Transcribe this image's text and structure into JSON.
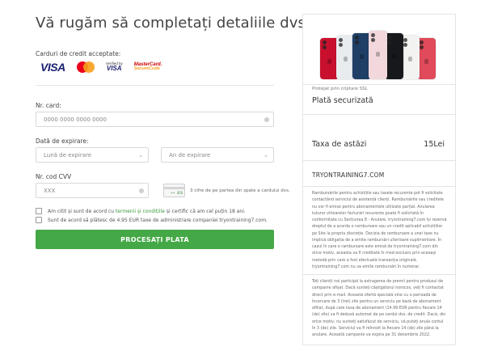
{
  "page": {
    "title": "Vă rugăm să completați detaliile dvs."
  },
  "accepted_cards": {
    "label": "Carduri de credit acceptate:",
    "visa_text": "VISA",
    "verified_top": "Verified by",
    "verified_visa": "VISA",
    "securecode_top": "MasterCard.",
    "securecode_bottom": "SecureCode"
  },
  "form": {
    "card_label": "Nr. card:",
    "card_placeholder": "0000 0000 0000 0000",
    "expiry_label": "Dată de expirare:",
    "month_select": "Lună de expirare",
    "year_select": "An de expirare",
    "cvv_label": "Nr. cod CVV",
    "cvv_placeholder": "XXX",
    "cvv_card_number": "•• 456",
    "cvv_hint": "3 cifre de pe partea din spate a cardului dvs.",
    "terms_before": "Am citit și sunt de acord cu ",
    "terms_link": "termenii și condițiile",
    "terms_after": " și certific că am cel puțin 18 ani.",
    "fee_text": "Sunt de acord să plătesc de 4.95 EUR taxe de administrare companiei tryontraining7.com.",
    "submit": "PROCESAȚI PLATA"
  },
  "sidebar": {
    "ssl": "Protejat prin criptare SSL",
    "secure_title": "Plată securizată",
    "tax_label": "Taxa de astăzi",
    "tax_value": "15Lei",
    "site": "TRYONTRAINING7.COM",
    "fine_print_1": "Rambursările pentru achizițiile sau taxele recurente pot fi solicitate contactând serviciul de asistență clienți. Rambursările sau creditele nu vor fi emise pentru abonamentele utilizate parțial. Anularea tuturor viitoarelor facturări recurente poate fi solicitată în conformitate cu Secțiunea 8 - Anulare. tryontraining7.com își rezervă dreptul de a acorda o rambursare sau un credit aplicabil achizițiilor pe Site la propria discreție. Decizia de rambursare a unei taxe nu implică obligația de a emite rambursări ulterioare suplimentare. În cazul în care o rambursare este emisă de tryontraining7.com din orice motiv, aceasta va fi creditată în mod exclusiv prin aceeași metodă prin care a fost efectuată tranzacția originală. tryontraining7.com nu va emite rambursări în numerar.",
    "fine_print_2": "Toți clienții noi participă la extragerea de premii pentru produsul de campanie afișat. Dacă sunteți câștigătorul norocos, veți fi contactat direct prin e-mail. Această ofertă specială vine cu o perioadă de încercare de 3 (trei) zile pentru un serviciu pe bază de abonament afiliat, după care taxa de abonament (14.99 EUR pentru fiecare 14 (de) zile) va fi dedusă automat de pe cardul dvs. de credit. Dacă, din orice motiv, nu sunteți satisfăcut de serviciu, vă puteți anula contul în 3 (de) zile. Serviciul va fi reînnoit la fiecare 14 (de) zile până la anulare. Această campanie va expira pe 31 decembrie 2022.",
    "phone_colors": [
      "#c8102e",
      "#e9ecef",
      "#1f3f66",
      "#f2d8dc",
      "#17181b",
      "#f3f3f1",
      "#e04a5a"
    ]
  },
  "colors": {
    "accent_green": "#44a846",
    "link_green": "#3a9a3d"
  }
}
